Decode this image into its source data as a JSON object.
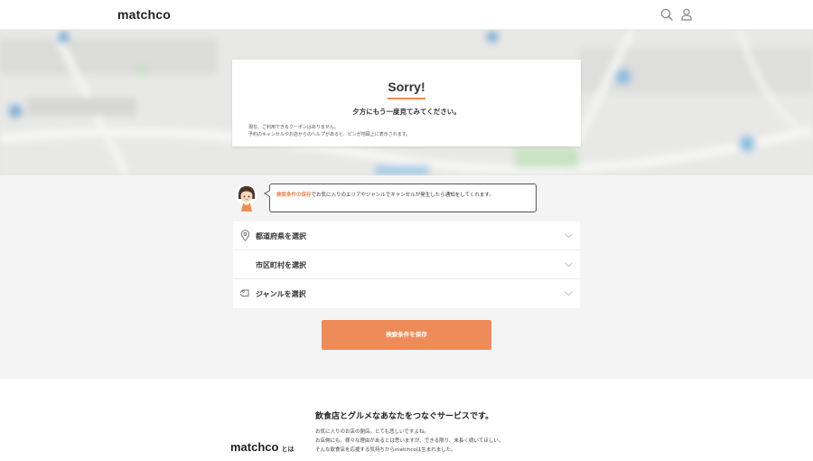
{
  "header": {
    "logo": "matchco",
    "icons": [
      "search-icon",
      "user-icon"
    ]
  },
  "sorry": {
    "title": "Sorry!",
    "subtitle": "夕方にもう一度見てみてください。",
    "note_line1": "現在、ご利用できるクーポンはありません。",
    "note_line2": "予約のキャンセルやお店からのヘルプがあると、ピンが地図上に表示されます。"
  },
  "notice": {
    "highlight": "検索条件の保存",
    "text": "でお気に入りのエリアやジャンルでキャンセルが発生したら通知をしてくれます。"
  },
  "filters": [
    {
      "label": "都道府県を選択",
      "icon": "map-pin-icon"
    },
    {
      "label": "市区町村を選択",
      "icon": ""
    },
    {
      "label": "ジャンルを選択",
      "icon": "tag-icon"
    }
  ],
  "save_button": "検索条件を保存",
  "about": {
    "logo": "matchco",
    "logo_suffix": "とは",
    "heading": "飲食店とグルメなあなたをつなぐサービスです。",
    "lines": [
      "お気に入りのお店の閉店。とても悲しいですよね。",
      "お店側にも、様々な理由があるとは思いますが、できる限り、末長く続いてほしい。",
      "そんな飲食店を応援する気持ちからmatchcoは生まれました。"
    ]
  },
  "colors": {
    "accent": "#ed8b59",
    "highlight_text": "#e9844f",
    "background": "#f4f4f4"
  }
}
